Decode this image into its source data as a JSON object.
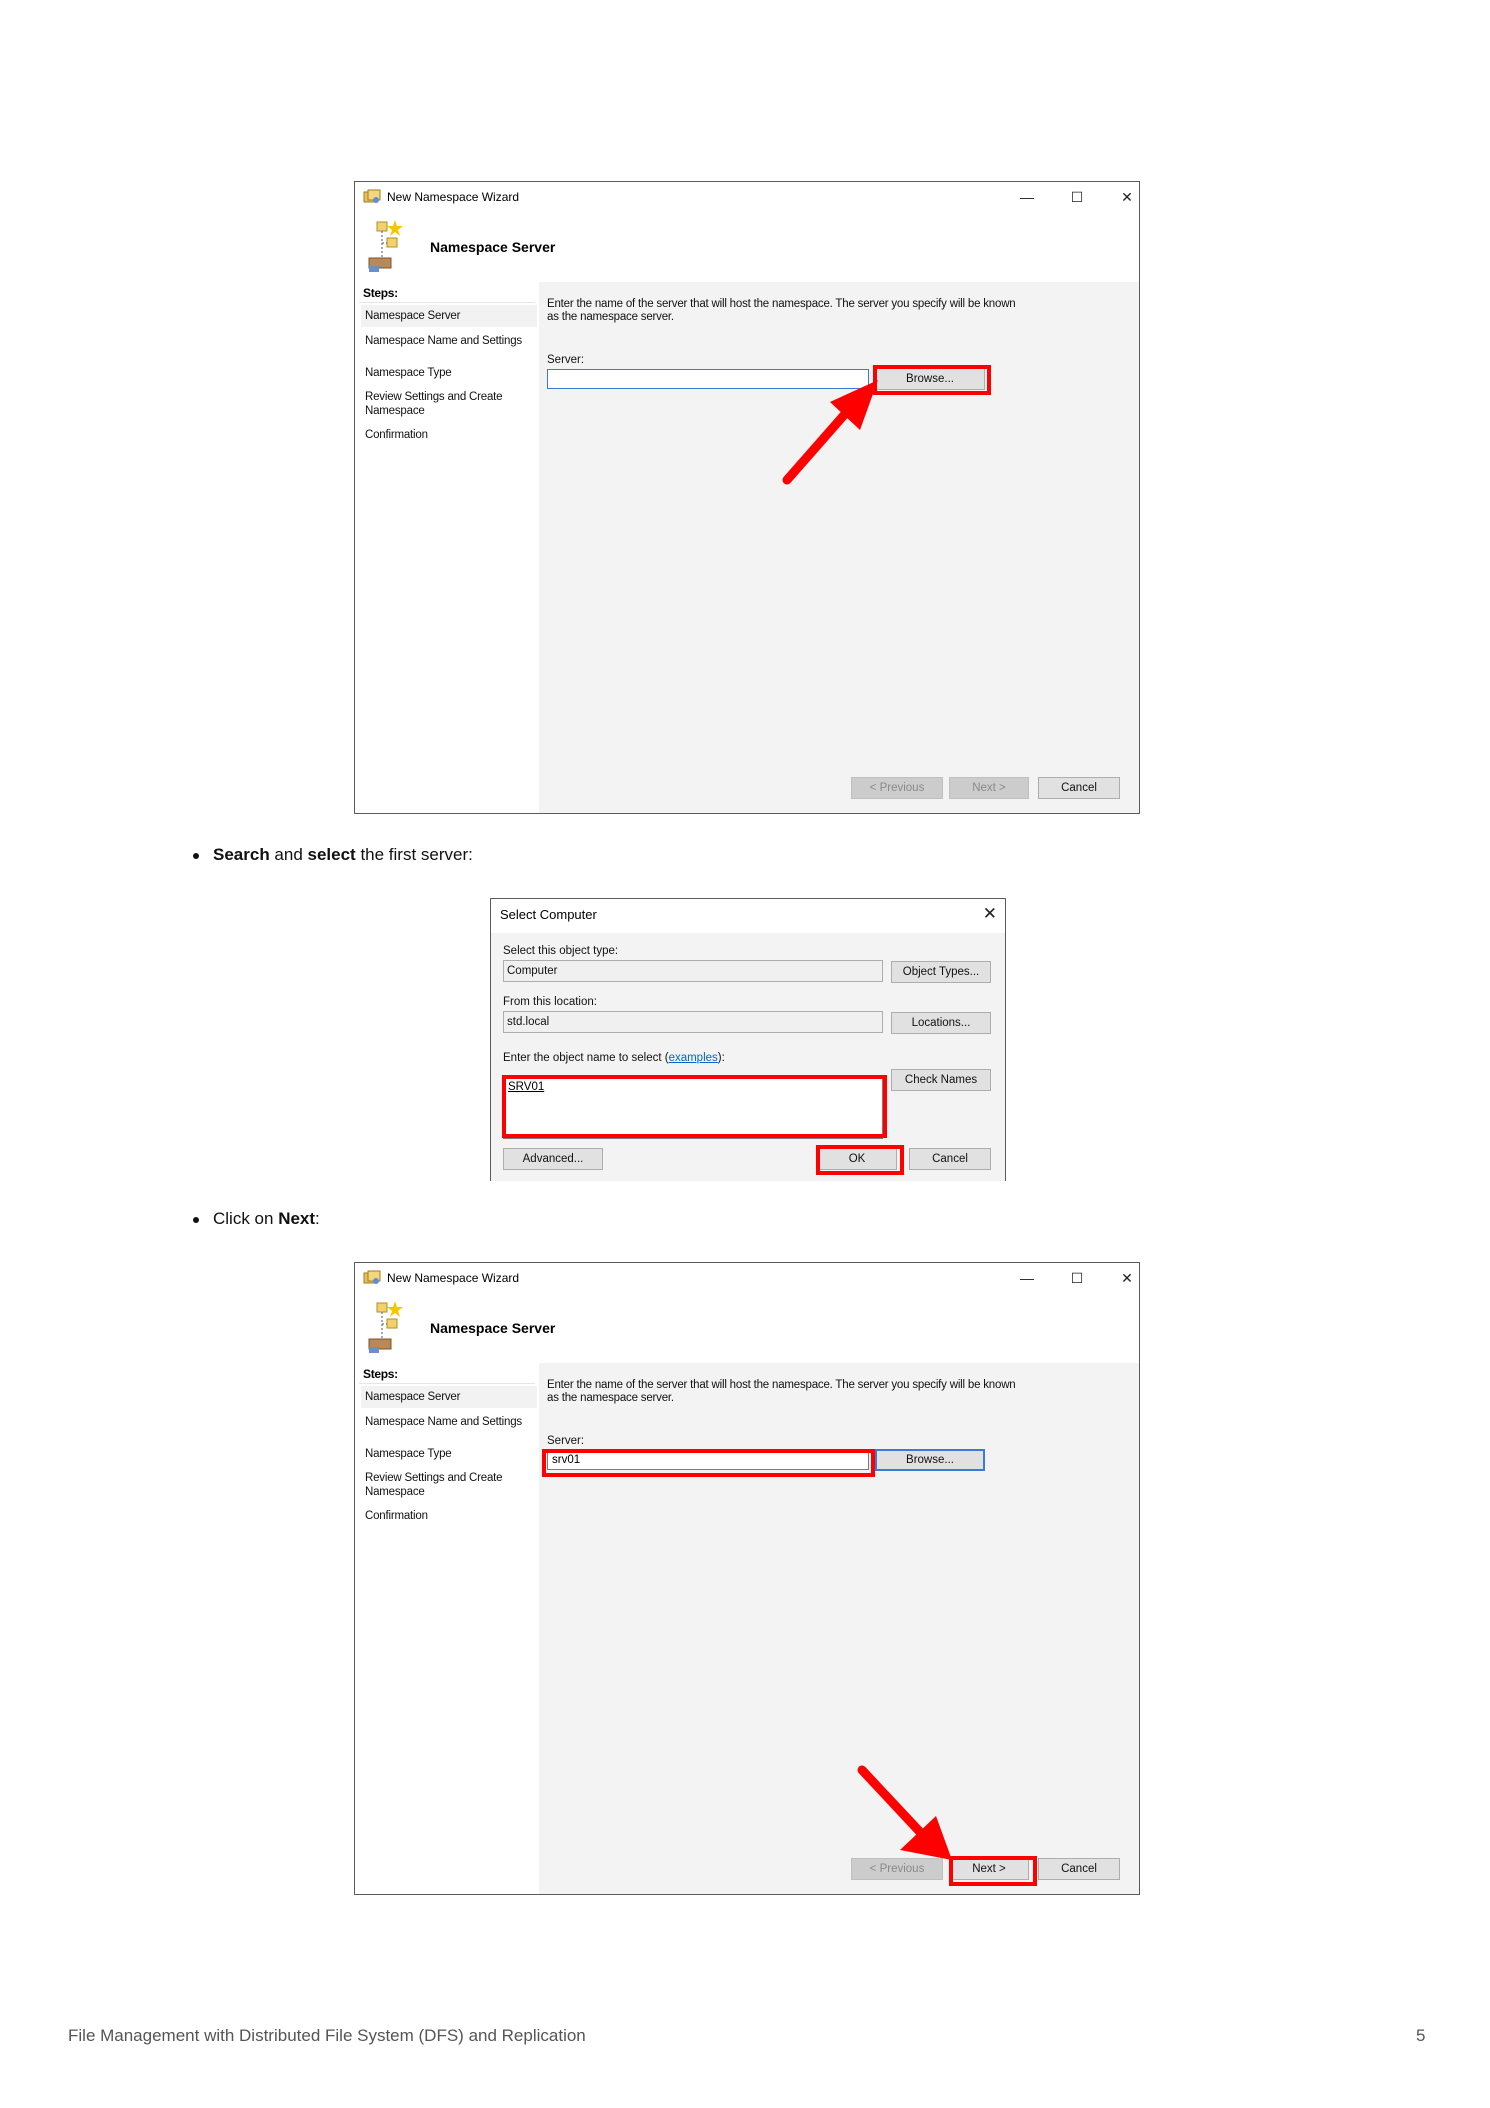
{
  "wizard": {
    "window_title": "New Namespace Wizard",
    "minimize": "—",
    "maximize": "☐",
    "close": "✕",
    "header_title": "Namespace Server",
    "steps_label": "Steps:",
    "steps": [
      "Namespace Server",
      "Namespace Name and Settings",
      "Namespace Type",
      "Review Settings and Create Namespace",
      "Confirmation"
    ],
    "description": "Enter the name of the server that will host the namespace. The server you specify will be known as the namespace server.",
    "server_label": "Server:",
    "browse_label": "Browse...",
    "previous_label": "< Previous",
    "next_label": "Next >",
    "cancel_label": "Cancel"
  },
  "screens": {
    "first": {
      "server_value": ""
    },
    "second": {
      "server_value": "srv01"
    }
  },
  "bullets": {
    "search": {
      "b1": "Search",
      "and": " and ",
      "b2": "select",
      "rest": " the first server:"
    },
    "next": {
      "pre": "Click on ",
      "b": "Next",
      "post": ":"
    }
  },
  "select_computer": {
    "title": "Select Computer",
    "close": "✕",
    "object_type_label": "Select this object type:",
    "object_type_value": "Computer",
    "object_types_button": "Object Types...",
    "location_label": "From this location:",
    "location_value": "std.local",
    "locations_button": "Locations...",
    "enter_label": "Enter the object name to select (",
    "examples_link": "examples",
    "enter_label_end": "):",
    "object_name_value": "SRV01",
    "check_names_button": "Check Names",
    "advanced_button": "Advanced...",
    "ok_button": "OK",
    "cancel_button": "Cancel"
  },
  "page_footer": {
    "title": "File Management with Distributed File System (DFS) and Replication",
    "page_number": "5"
  },
  "colors": {
    "highlight": "#ff0000",
    "focus": "#3a7bd5"
  }
}
